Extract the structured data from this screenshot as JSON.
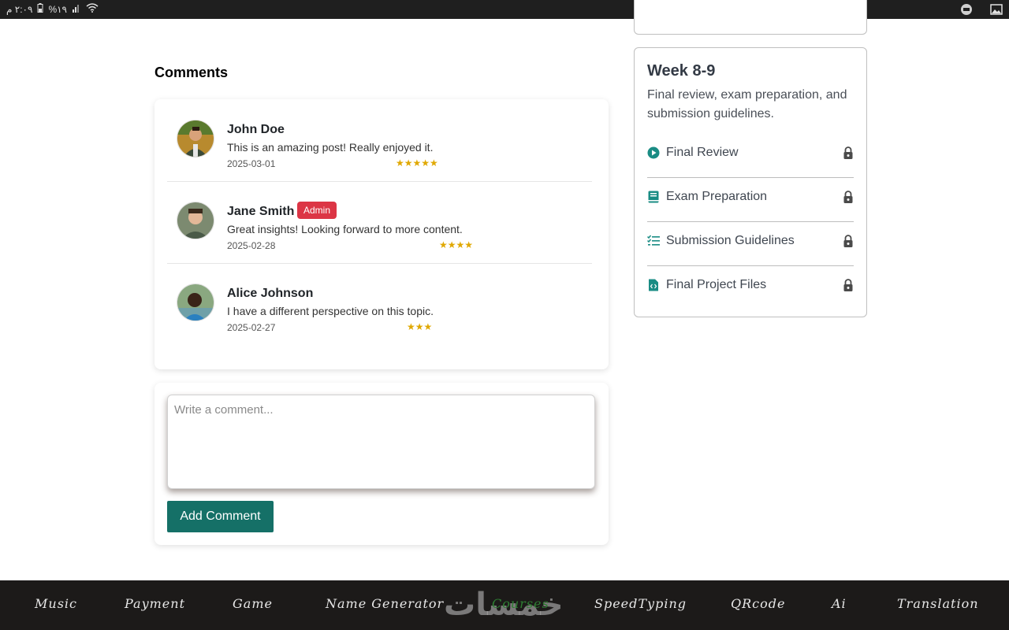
{
  "status_bar": {
    "time_text": "٢:٠٩ م",
    "battery_text": "%١٩"
  },
  "comments": {
    "title": "Comments",
    "items": [
      {
        "name": "John Doe",
        "text": "This is an amazing post! Really enjoyed it.",
        "date": "2025-03-01",
        "stars": "★★★★★",
        "rating": 5,
        "badge": ""
      },
      {
        "name": "Jane Smith",
        "text": "Great insights! Looking forward to more content.",
        "date": "2025-02-28",
        "stars": "★★★★",
        "rating": 4,
        "badge": "Admin"
      },
      {
        "name": "Alice Johnson",
        "text": "I have a different perspective on this topic.",
        "date": "2025-02-27",
        "stars": "★★★",
        "rating": 3,
        "badge": ""
      }
    ]
  },
  "add_comment": {
    "placeholder": "Write a comment...",
    "button_label": "Add Comment"
  },
  "week": {
    "title": "Week 8-9",
    "description": "Final review, exam preparation, and submission guidelines.",
    "lessons": [
      {
        "label": "Final Review",
        "icon": "play-circle-icon",
        "locked": true
      },
      {
        "label": "Exam Preparation",
        "icon": "book-icon",
        "locked": true
      },
      {
        "label": "Submission Guidelines",
        "icon": "checklist-icon",
        "locked": true
      },
      {
        "label": "Final Project Files",
        "icon": "code-file-icon",
        "locked": true
      }
    ]
  },
  "footer": {
    "nav": [
      "Music",
      "Payment",
      "Game",
      "Name Generator",
      "Courses",
      "SpeedTyping",
      "QRcode",
      "Ai",
      "Translation"
    ],
    "active": "Courses",
    "watermark": "خمسات"
  },
  "colors": {
    "accent": "#157067",
    "icon_teal": "#1a8c84",
    "badge_red": "#dc3545",
    "star": "#e0a800",
    "footer_bg": "#1c1a19",
    "nav_active": "#2e7d32"
  }
}
